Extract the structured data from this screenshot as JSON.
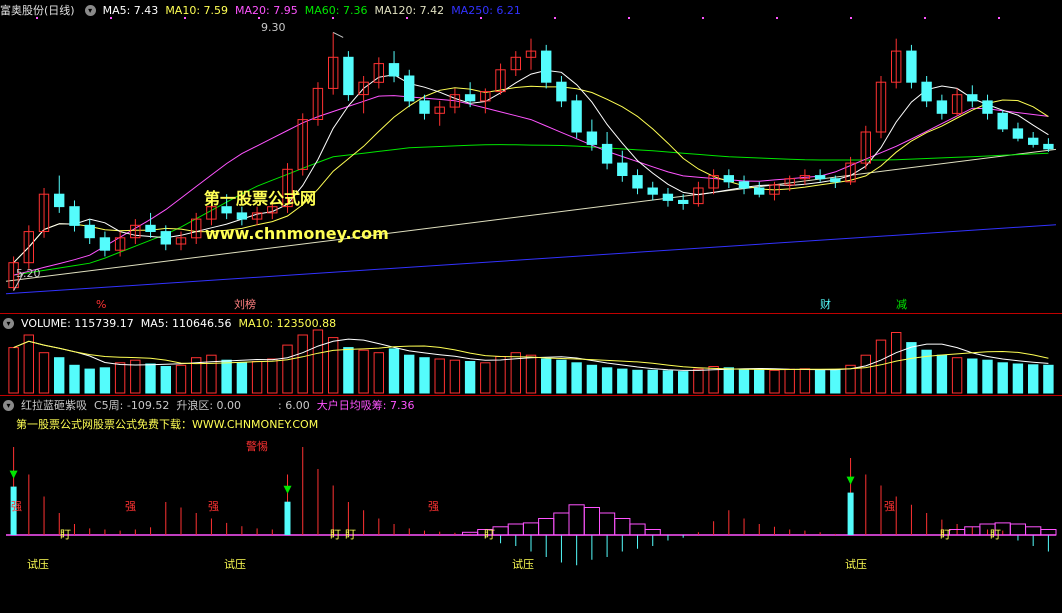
{
  "window_title": "富奥股份(日线)",
  "colors": {
    "up": "#ff3232",
    "down": "#54fcfc",
    "ma5": "#ffffff",
    "ma10": "#ffff54",
    "ma20": "#ff54ff",
    "ma60": "#00e600",
    "ma120": "#e0e0c0",
    "ma250": "#3232ff",
    "purple": "#ff54ff",
    "cyan": "#54fcfc",
    "red": "#ff3232",
    "yellow": "#ffff54"
  },
  "ma_legend": [
    {
      "label": "MA5: 7.43",
      "color": "#ffffff"
    },
    {
      "label": "MA10: 7.59",
      "color": "#ffff54"
    },
    {
      "label": "MA20: 7.95",
      "color": "#ff54ff"
    },
    {
      "label": "MA60: 7.36",
      "color": "#00e600"
    },
    {
      "label": "MA120: 7.42",
      "color": "#e0e0c0"
    },
    {
      "label": "MA250: 6.21",
      "color": "#3232ff"
    }
  ],
  "price_high_label": "9.30",
  "price_low_label": "5.20",
  "event_markers": [
    {
      "text": "%",
      "color": "#ff3232"
    },
    {
      "text": "刘榜",
      "color": "#ff8080"
    },
    {
      "text": "财",
      "color": "#54fcfc"
    },
    {
      "text": "减",
      "color": "#00e600"
    }
  ],
  "watermark": {
    "title": "第一股票公式网",
    "url": "www.chnmoney.com"
  },
  "volume_legend": [
    {
      "label": "VOLUME: 115739.17",
      "color": "#ffffff"
    },
    {
      "label": "MA5: 110646.56",
      "color": "#ffffff"
    },
    {
      "label": "MA10: 123500.88",
      "color": "#ffff54"
    }
  ],
  "indicator_legend": [
    {
      "label": "红拉蓝砸紫吸",
      "color": "#c8c8c8"
    },
    {
      "label": "C5周: -109.52",
      "color": "#c8c8c8"
    },
    {
      "label": "升浪区: 0.00",
      "color": "#c8c8c8"
    },
    {
      "label": ": 6.00",
      "color": "#c8c8c8"
    },
    {
      "label": "大户日均吸筹: 7.36",
      "color": "#ff54ff"
    }
  ],
  "indicator_note": "第一股票公式网股票公式免费下载：WWW.CHNMONEY.COM",
  "indicator_labels": {
    "warning": "警惕",
    "strong": "强",
    "stare": "盯",
    "test": "试压"
  },
  "chart_data": [
    {
      "type": "candlestick",
      "title": "富奥股份(日线)",
      "ylim": [
        5.0,
        9.5
      ],
      "annotations": [
        {
          "text": "9.30",
          "note": "period high"
        },
        {
          "text": "5.20",
          "note": "period low"
        }
      ],
      "series_names": [
        "MA5",
        "MA10",
        "MA20",
        "MA60",
        "MA120",
        "MA250"
      ],
      "ma250": {
        "start": 5.1,
        "end": 6.21
      },
      "ma120": {
        "start": 5.3,
        "end": 7.42
      },
      "ma60": [
        5.4,
        5.6,
        6.1,
        6.8,
        7.3,
        7.45,
        7.5,
        7.48,
        7.4,
        7.3,
        7.25,
        7.25,
        7.3,
        7.36
      ],
      "ma20": [
        5.4,
        5.7,
        6.4,
        7.3,
        7.9,
        8.3,
        8.2,
        7.9,
        7.4,
        7.0,
        6.9,
        7.0,
        7.5,
        8.1,
        7.95
      ],
      "ohlc": [
        [
          5.2,
          5.7,
          5.15,
          5.6
        ],
        [
          5.6,
          6.2,
          5.5,
          6.1
        ],
        [
          6.1,
          6.8,
          6.0,
          6.7
        ],
        [
          6.7,
          7.0,
          6.4,
          6.5
        ],
        [
          6.5,
          6.6,
          6.1,
          6.2
        ],
        [
          6.2,
          6.3,
          5.9,
          6.0
        ],
        [
          6.0,
          6.1,
          5.7,
          5.8
        ],
        [
          5.8,
          6.1,
          5.7,
          6.0
        ],
        [
          6.0,
          6.3,
          5.9,
          6.2
        ],
        [
          6.2,
          6.4,
          6.0,
          6.1
        ],
        [
          6.1,
          6.2,
          5.8,
          5.9
        ],
        [
          5.9,
          6.1,
          5.8,
          6.0
        ],
        [
          6.0,
          6.4,
          5.9,
          6.3
        ],
        [
          6.3,
          6.6,
          6.2,
          6.5
        ],
        [
          6.5,
          6.7,
          6.3,
          6.4
        ],
        [
          6.4,
          6.5,
          6.2,
          6.3
        ],
        [
          6.3,
          6.5,
          6.2,
          6.4
        ],
        [
          6.4,
          6.6,
          6.3,
          6.5
        ],
        [
          6.5,
          7.2,
          6.4,
          7.1
        ],
        [
          7.1,
          8.0,
          7.0,
          7.9
        ],
        [
          7.9,
          8.5,
          7.8,
          8.4
        ],
        [
          8.4,
          9.3,
          8.3,
          8.9
        ],
        [
          8.9,
          9.0,
          8.2,
          8.3
        ],
        [
          8.3,
          8.6,
          8.0,
          8.5
        ],
        [
          8.5,
          8.9,
          8.4,
          8.8
        ],
        [
          8.8,
          9.0,
          8.5,
          8.6
        ],
        [
          8.6,
          8.7,
          8.1,
          8.2
        ],
        [
          8.2,
          8.3,
          7.9,
          8.0
        ],
        [
          8.0,
          8.2,
          7.8,
          8.1
        ],
        [
          8.1,
          8.4,
          8.0,
          8.3
        ],
        [
          8.3,
          8.5,
          8.1,
          8.2
        ],
        [
          8.2,
          8.4,
          8.0,
          8.35
        ],
        [
          8.35,
          8.8,
          8.3,
          8.7
        ],
        [
          8.7,
          9.0,
          8.6,
          8.9
        ],
        [
          8.9,
          9.2,
          8.7,
          9.0
        ],
        [
          9.0,
          9.1,
          8.4,
          8.5
        ],
        [
          8.5,
          8.6,
          8.1,
          8.2
        ],
        [
          8.2,
          8.3,
          7.6,
          7.7
        ],
        [
          7.7,
          7.9,
          7.4,
          7.5
        ],
        [
          7.5,
          7.7,
          7.1,
          7.2
        ],
        [
          7.2,
          7.4,
          6.9,
          7.0
        ],
        [
          7.0,
          7.1,
          6.7,
          6.8
        ],
        [
          6.8,
          6.9,
          6.6,
          6.7
        ],
        [
          6.7,
          6.8,
          6.5,
          6.6
        ],
        [
          6.6,
          6.7,
          6.45,
          6.55
        ],
        [
          6.55,
          6.9,
          6.5,
          6.8
        ],
        [
          6.8,
          7.1,
          6.7,
          7.0
        ],
        [
          7.0,
          7.1,
          6.8,
          6.9
        ],
        [
          6.9,
          7.0,
          6.7,
          6.8
        ],
        [
          6.8,
          6.9,
          6.65,
          6.7
        ],
        [
          6.7,
          6.9,
          6.6,
          6.85
        ],
        [
          6.85,
          7.0,
          6.75,
          6.95
        ],
        [
          6.95,
          7.1,
          6.85,
          7.0
        ],
        [
          7.0,
          7.1,
          6.9,
          6.95
        ],
        [
          6.95,
          7.0,
          6.8,
          6.9
        ],
        [
          6.9,
          7.3,
          6.85,
          7.2
        ],
        [
          7.2,
          7.8,
          7.1,
          7.7
        ],
        [
          7.7,
          8.6,
          7.6,
          8.5
        ],
        [
          8.5,
          9.2,
          8.4,
          9.0
        ],
        [
          9.0,
          9.1,
          8.4,
          8.5
        ],
        [
          8.5,
          8.6,
          8.1,
          8.2
        ],
        [
          8.2,
          8.3,
          7.9,
          8.0
        ],
        [
          8.0,
          8.4,
          7.95,
          8.3
        ],
        [
          8.3,
          8.45,
          8.1,
          8.2
        ],
        [
          8.2,
          8.3,
          7.9,
          8.0
        ],
        [
          8.0,
          8.05,
          7.7,
          7.75
        ],
        [
          7.75,
          7.85,
          7.55,
          7.6
        ],
        [
          7.6,
          7.7,
          7.45,
          7.5
        ],
        [
          7.5,
          7.6,
          7.38,
          7.43
        ]
      ]
    },
    {
      "type": "bar",
      "title": "VOLUME",
      "series_names": [
        "VOLUME",
        "MA5",
        "MA10"
      ],
      "last": {
        "VOLUME": 115739.17,
        "MA5": 110646.56,
        "MA10": 123500.88
      },
      "values": [
        180,
        230,
        160,
        140,
        110,
        95,
        100,
        120,
        130,
        115,
        105,
        110,
        140,
        150,
        130,
        120,
        125,
        135,
        190,
        230,
        250,
        220,
        180,
        170,
        160,
        175,
        150,
        140,
        135,
        130,
        125,
        120,
        145,
        160,
        150,
        135,
        130,
        120,
        110,
        100,
        95,
        90,
        90,
        88,
        85,
        95,
        105,
        100,
        95,
        92,
        90,
        94,
        96,
        92,
        90,
        110,
        150,
        210,
        240,
        200,
        170,
        150,
        140,
        135,
        130,
        120,
        115,
        112,
        110
      ]
    },
    {
      "type": "bar",
      "title": "红拉蓝砸紫吸",
      "values": [
        160,
        110,
        70,
        40,
        20,
        12,
        10,
        8,
        10,
        14,
        60,
        50,
        40,
        30,
        22,
        16,
        12,
        10,
        110,
        160,
        120,
        90,
        60,
        45,
        30,
        20,
        12,
        8,
        6,
        4,
        2,
        -5,
        -15,
        -20,
        -30,
        -40,
        -50,
        -55,
        -45,
        -40,
        -30,
        -25,
        -20,
        -10,
        -5,
        5,
        25,
        45,
        30,
        20,
        15,
        10,
        8,
        5,
        2,
        140,
        110,
        90,
        70,
        55,
        40,
        28,
        20,
        15,
        10,
        8,
        -10,
        -20,
        -30
      ],
      "purple_wave": [
        0,
        0,
        0,
        0,
        0,
        0,
        0,
        0,
        0,
        0,
        0,
        0,
        0,
        0,
        0,
        0,
        0,
        0,
        0,
        0,
        0,
        0,
        0,
        0,
        0,
        0,
        0,
        0,
        0,
        0,
        5,
        10,
        15,
        20,
        22,
        30,
        40,
        55,
        50,
        40,
        30,
        20,
        10,
        0,
        0,
        0,
        0,
        0,
        0,
        0,
        0,
        0,
        0,
        0,
        0,
        0,
        0,
        0,
        0,
        0,
        0,
        0,
        10,
        15,
        20,
        22,
        20,
        15,
        10
      ]
    }
  ]
}
